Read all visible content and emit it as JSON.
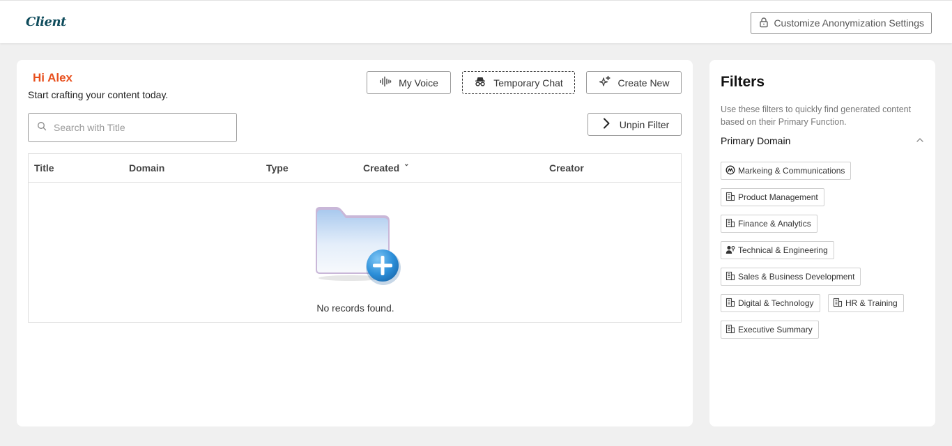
{
  "header": {
    "logo_text": "Client",
    "customize_label": "Customize Anonymization Settings"
  },
  "main": {
    "greeting": "Hi Alex",
    "subline": "Start crafting your content today.",
    "buttons": {
      "my_voice": "My Voice",
      "temporary_chat": "Temporary Chat",
      "create_new": "Create New",
      "unpin_filter": "Unpin Filter"
    },
    "search": {
      "placeholder": "Search with Title",
      "value": ""
    },
    "table": {
      "columns": [
        "Title",
        "Domain",
        "Type",
        "Created",
        "Creator"
      ],
      "rows": [],
      "empty_text": "No records found."
    }
  },
  "filters": {
    "title": "Filters",
    "description": "Use these filters to quickly find generated content based on their Primary Function.",
    "section_title": "Primary Domain",
    "chips": [
      {
        "label": "Markeing & Communications",
        "icon": "marketing-icon"
      },
      {
        "label": "Product Management",
        "icon": "building-icon"
      },
      {
        "label": "Finance & Analytics",
        "icon": "building-icon"
      },
      {
        "label": "Technical & Engineering",
        "icon": "engineer-icon"
      },
      {
        "label": "Sales & Business Development",
        "icon": "building-icon"
      },
      {
        "label": "Digital & Technology",
        "icon": "building-icon"
      },
      {
        "label": "HR & Training",
        "icon": "building-icon"
      },
      {
        "label": "Executive Summary",
        "icon": "building-icon"
      }
    ]
  },
  "colors": {
    "accent": "#e8501e",
    "logo": "#0f4c5c",
    "background": "#f0f0f0"
  }
}
